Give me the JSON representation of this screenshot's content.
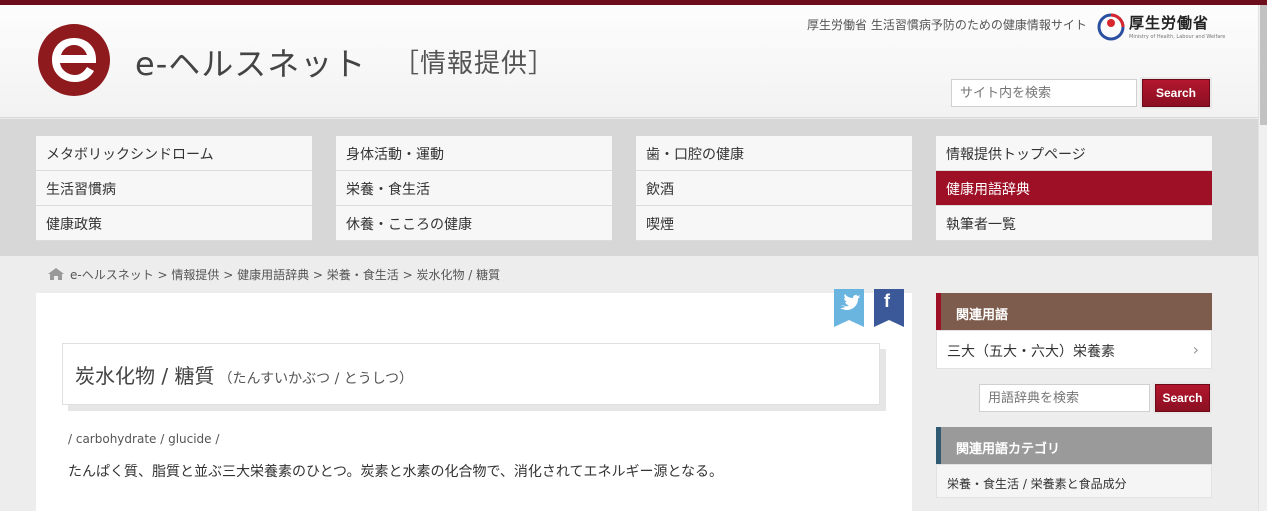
{
  "header": {
    "site_name": "e-ヘルスネット",
    "site_tag": "［情報提供］",
    "ministry_text": "厚生労働省 生活習慣病予防のための健康情報サイト",
    "ministry_name": "厚生労働省",
    "ministry_name_en": "Ministry of Health, Labour and Welfare",
    "search_placeholder": "サイト内を検索",
    "search_label": "Search"
  },
  "nav": {
    "col1": [
      "メタボリックシンドローム",
      "生活習慣病",
      "健康政策"
    ],
    "col2": [
      "身体活動・運動",
      "栄養・食生活",
      "休養・こころの健康"
    ],
    "col3": [
      "歯・口腔の健康",
      "飲酒",
      "喫煙"
    ],
    "col4": [
      "情報提供トップページ",
      "健康用語辞典",
      "執筆者一覧"
    ],
    "active": "健康用語辞典"
  },
  "breadcrumb": "e-ヘルスネット > 情報提供 > 健康用語辞典 > 栄養・食生活 > 炭水化物 / 糖質",
  "share": {
    "twitter_icon": "twitter-bird-icon",
    "facebook_letter": "f"
  },
  "term": {
    "title": "炭水化物 / 糖質",
    "reading": "（たんすいかぶつ / とうしつ）",
    "english": "/ carbohydrate / glucide /",
    "description": "たんぱく質、脂質と並ぶ三大栄養素のひとつ。炭素と水素の化合物で、消化されてエネルギー源となる。"
  },
  "sidebar": {
    "related_heading": "関連用語",
    "related_item": "三大（五大・六大）栄養素",
    "dict_search_placeholder": "用語辞典を検索",
    "dict_search_label": "Search",
    "category_heading": "関連用語カテゴリ",
    "category_item": "栄養・食生活 / 栄養素と食品成分"
  },
  "colors": {
    "brand": "#9e1026",
    "dark_brand": "#6e0d1c",
    "related_head": "#7d5c4e"
  }
}
